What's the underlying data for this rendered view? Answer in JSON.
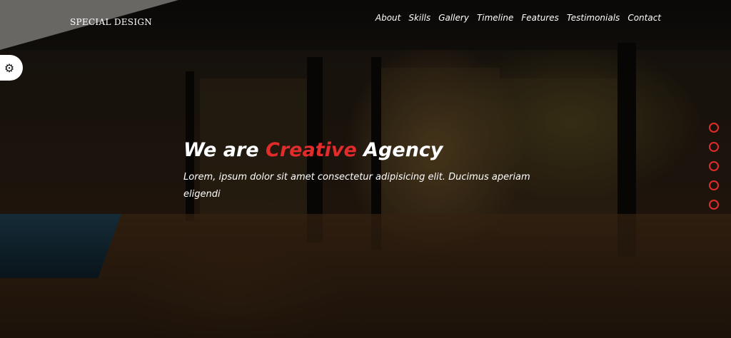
{
  "header": {
    "logo": "SPECIAL DESIGN",
    "nav": [
      "About",
      "Skills",
      "Gallery",
      "Timeline",
      "Features",
      "Testimonials",
      "Contact"
    ]
  },
  "settings": {
    "icon": "gear-icon"
  },
  "hero": {
    "headline_part1": "We are ",
    "headline_accent": "Creative",
    "headline_part2": " Agency",
    "text": "Lorem, ipsum dolor sit amet consectetur adipisicing elit. Ducimus aperiam eligendi"
  },
  "bullets": {
    "count": 5
  },
  "colors": {
    "accent": "#e22c2c",
    "text": "#ffffff"
  }
}
